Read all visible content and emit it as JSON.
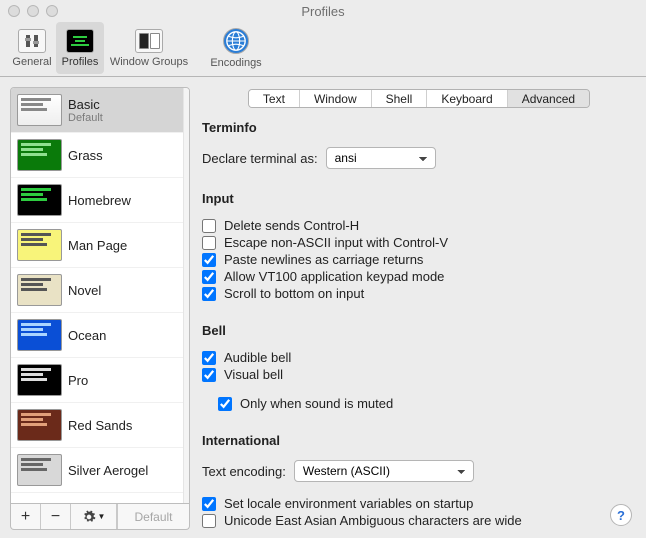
{
  "window": {
    "title": "Profiles"
  },
  "toolbar": [
    {
      "label": "General",
      "icon": "gear"
    },
    {
      "label": "Profiles",
      "icon": "term",
      "selected": true
    },
    {
      "label": "Window Groups",
      "icon": "wg"
    },
    {
      "label": "Encodings",
      "icon": "globe"
    }
  ],
  "profiles": [
    {
      "name": "Basic",
      "sub": "Default",
      "theme": "basic",
      "selected": true
    },
    {
      "name": "Grass",
      "theme": "grass"
    },
    {
      "name": "Homebrew",
      "theme": "homebrew"
    },
    {
      "name": "Man Page",
      "theme": "manpage"
    },
    {
      "name": "Novel",
      "theme": "novel"
    },
    {
      "name": "Ocean",
      "theme": "ocean"
    },
    {
      "name": "Pro",
      "theme": "pro"
    },
    {
      "name": "Red Sands",
      "theme": "redsands"
    },
    {
      "name": "Silver Aerogel",
      "theme": "silver"
    }
  ],
  "sidebar_buttons": {
    "default_button": "Default"
  },
  "tabs": [
    {
      "label": "Text"
    },
    {
      "label": "Window"
    },
    {
      "label": "Shell"
    },
    {
      "label": "Keyboard"
    },
    {
      "label": "Advanced",
      "selected": true
    }
  ],
  "sections": {
    "terminfo": {
      "title": "Terminfo",
      "declare_label": "Declare terminal as:",
      "declare_value": "ansi"
    },
    "input": {
      "title": "Input",
      "options": [
        {
          "label": "Delete sends Control-H",
          "checked": false
        },
        {
          "label": "Escape non-ASCII input with Control-V",
          "checked": false
        },
        {
          "label": "Paste newlines as carriage returns",
          "checked": true
        },
        {
          "label": "Allow VT100 application keypad mode",
          "checked": true
        },
        {
          "label": "Scroll to bottom on input",
          "checked": true
        }
      ]
    },
    "bell": {
      "title": "Bell",
      "options": [
        {
          "label": "Audible bell",
          "checked": true
        },
        {
          "label": "Visual bell",
          "checked": true
        }
      ],
      "sub_option": {
        "label": "Only when sound is muted",
        "checked": true
      }
    },
    "international": {
      "title": "International",
      "encoding_label": "Text encoding:",
      "encoding_value": "Western (ASCII)",
      "options": [
        {
          "label": "Set locale environment variables on startup",
          "checked": true
        },
        {
          "label": "Unicode East Asian Ambiguous characters are wide",
          "checked": false
        }
      ]
    }
  },
  "help_label": "?"
}
